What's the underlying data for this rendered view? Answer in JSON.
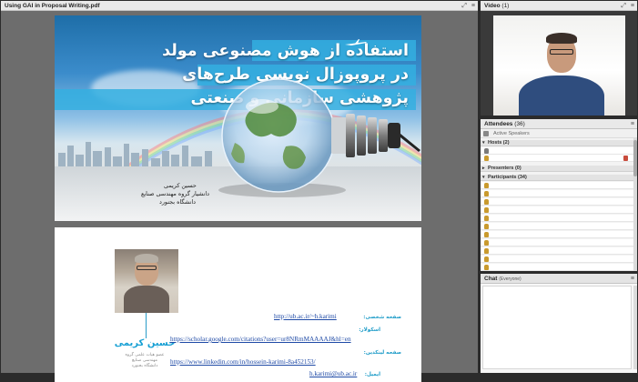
{
  "share_pod": {
    "title": "Using GAI in Proposal Writing.pdf",
    "fullscreen_icon": "fullscreen-icon",
    "menu_icon": "menu-icon"
  },
  "slide1": {
    "title_lines": [
      "استفاده از هوش مصنوعی مولد",
      "در پروپوزال نویسی طرح‌های",
      "پژوهشی سازمانی و صنعتی"
    ],
    "author_name": "حسین کریمی",
    "author_position": "دانشیار گروه مهندسی صنایع",
    "author_university": "دانشگاه بجنورد"
  },
  "slide2": {
    "name": "حسین کریمی",
    "subtitle_lines": [
      "عضو هیات علمی گروه",
      "مهندسی صنایع",
      "دانشگاه بجنورد"
    ],
    "homepage_label": "صفحه شخصی:",
    "homepage_url": "http://ub.ac.ir/~h.karimi",
    "scholar_label": "اسکولار:",
    "scholar_url": "https://scholar.google.com/citations?user=ur8NRmMAAAAJ&hl=en",
    "linkedin_label": "صفحه لینکدین:",
    "linkedin_url": "https://www.linkedin.com/in/hossein-karimi-8a452153/",
    "email_label": "ایمیل:",
    "email": "h.karimi@ub.ac.ir"
  },
  "video_pod": {
    "title": "Video",
    "count": "(1)",
    "fullscreen_icon": "fullscreen-icon",
    "menu_icon": "menu-icon"
  },
  "attendees_pod": {
    "title": "Attendees",
    "count": "(36)",
    "active_speakers": "Active Speakers",
    "sections": [
      {
        "label": "Hosts (2)",
        "expanded": true
      },
      {
        "label": "Presenters (0)",
        "expanded": false
      },
      {
        "label": "Participants (34)",
        "expanded": true
      }
    ],
    "host_rows": 2,
    "participant_rows_visible": 10
  },
  "chat_pod": {
    "title": "Chat",
    "audience": "(Everyone)"
  },
  "colors": {
    "accent_blue": "#17a0d4",
    "link_blue": "#1f4aa6",
    "pod_header": "#e9e9e9"
  }
}
